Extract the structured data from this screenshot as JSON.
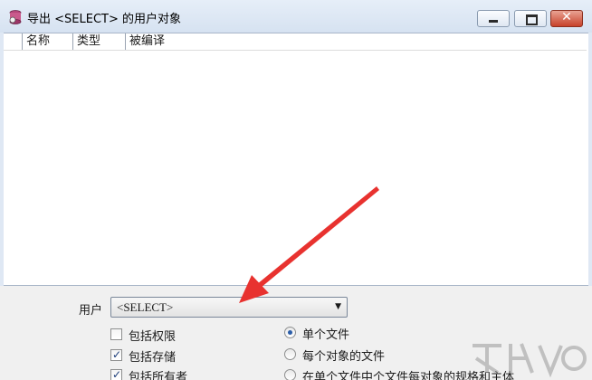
{
  "window": {
    "title": "导出 <SELECT> 的用户对象",
    "controls": {
      "minimize": "minimize",
      "maximize": "maximize",
      "close": "✕"
    }
  },
  "list": {
    "columns": [
      "名称",
      "类型",
      "被编译"
    ],
    "rows": []
  },
  "options": {
    "user_label": "用户",
    "user_value": "<SELECT>",
    "checkboxes": [
      {
        "label": "包括权限",
        "checked": false
      },
      {
        "label": "包括存储",
        "checked": true
      },
      {
        "label": "包括所有者",
        "checked": true
      }
    ],
    "radios": [
      {
        "label": "单个文件",
        "selected": true
      },
      {
        "label": "每个对象的文件",
        "selected": false
      },
      {
        "label": "在单个文件中个文件每对象的规格和主体",
        "selected": false
      }
    ]
  },
  "colors": {
    "annotation_arrow": "#e8322f",
    "window_frame": "#dfe8f4",
    "close_button": "#c7412a"
  }
}
